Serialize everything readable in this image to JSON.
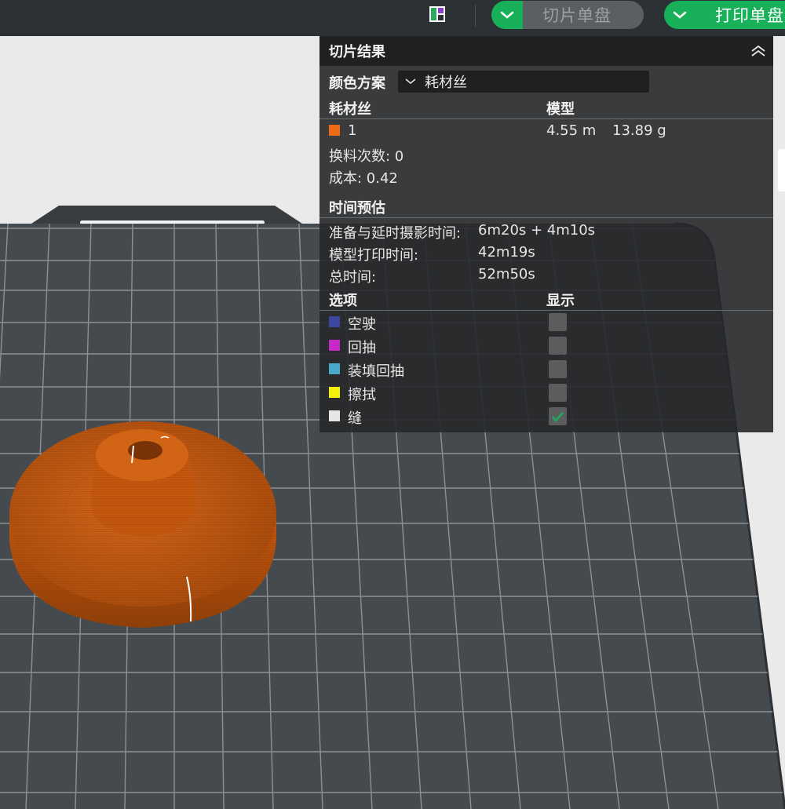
{
  "toolbar": {
    "layout_icon": "layout-icon",
    "slice_plate_label": "切片单盘",
    "print_plate_label": "打印单盘",
    "accent_color": "#18b15a"
  },
  "slice_result": {
    "title": "切片结果",
    "color_scheme_label": "颜色方案",
    "color_scheme_value": "耗材丝",
    "filament_header": "耗材丝",
    "model_header": "模型",
    "filament": {
      "id": "1",
      "color": "#f06a15",
      "length": "4.55 m",
      "weight": "13.89 g"
    },
    "filament_changes": "换料次数: 0",
    "cost": "成本: 0.42",
    "time_header": "时间预估",
    "times": [
      {
        "label": "准备与延时摄影时间:",
        "value": "6m20s + 4m10s"
      },
      {
        "label": "模型打印时间:",
        "value": "42m19s"
      },
      {
        "label": "总时间:",
        "value": "52m50s"
      }
    ],
    "options_header": "选项",
    "display_header": "显示",
    "options": [
      {
        "label": "空驶",
        "color": "#3c48a0",
        "checked": false
      },
      {
        "label": "回抽",
        "color": "#c829c8",
        "checked": false
      },
      {
        "label": "装填回抽",
        "color": "#49a9cc",
        "checked": false
      },
      {
        "label": "擦拭",
        "color": "#f4f00a",
        "checked": false
      },
      {
        "label": "缝",
        "color": "#e6e6e6",
        "checked": true
      }
    ]
  }
}
